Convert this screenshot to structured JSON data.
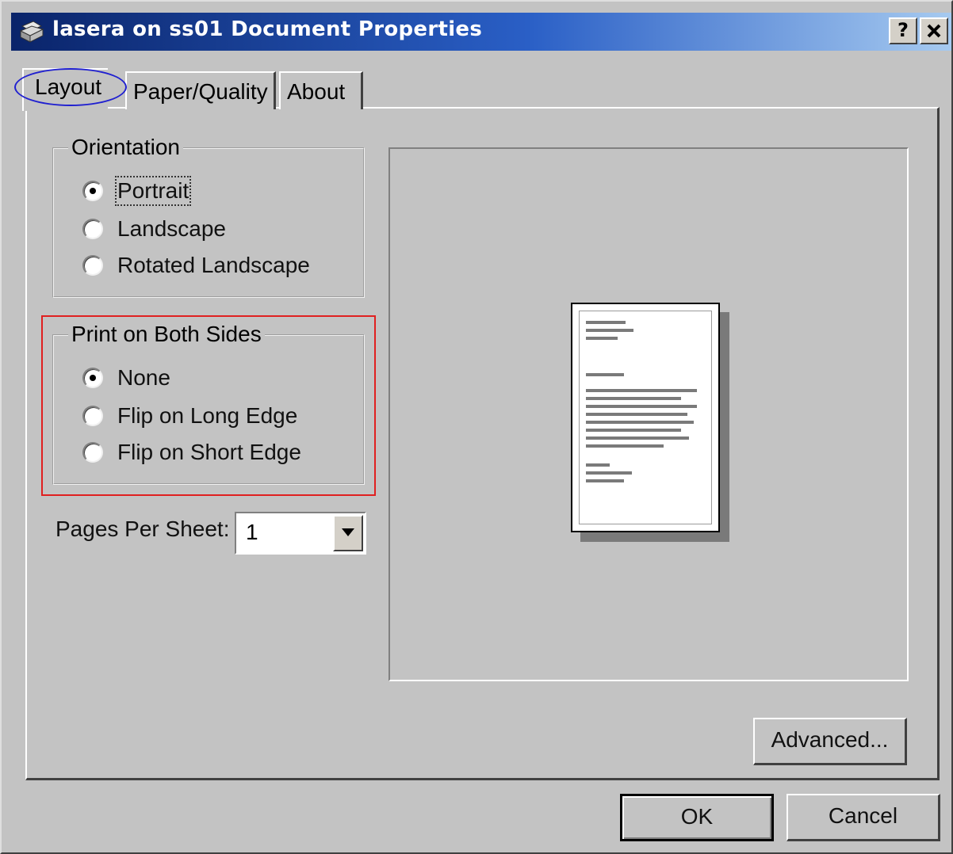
{
  "window": {
    "title": "lasera on ss01 Document Properties",
    "icon": "printer-icon",
    "help_button": "?",
    "close_button": "✕"
  },
  "tabs": [
    {
      "label": "Layout",
      "selected": true
    },
    {
      "label": "Paper/Quality",
      "selected": false
    },
    {
      "label": "About",
      "selected": false
    }
  ],
  "orientation": {
    "legend": "Orientation",
    "options": [
      {
        "label": "Portrait",
        "checked": true
      },
      {
        "label": "Landscape",
        "checked": false
      },
      {
        "label": "Rotated Landscape",
        "checked": false
      }
    ]
  },
  "duplex": {
    "legend": "Print on Both Sides",
    "options": [
      {
        "label": "None",
        "checked": true
      },
      {
        "label": "Flip on Long Edge",
        "checked": false
      },
      {
        "label": "Flip on Short Edge",
        "checked": false
      }
    ]
  },
  "pages_per_sheet": {
    "label": "Pages Per Sheet:",
    "value": "1"
  },
  "buttons": {
    "advanced": "Advanced...",
    "ok": "OK",
    "cancel": "Cancel"
  },
  "colors": {
    "titlebar_start": "#0a246a",
    "titlebar_end": "#a6caf0",
    "highlight_ellipse": "#2020d0",
    "highlight_box": "#e02020"
  }
}
